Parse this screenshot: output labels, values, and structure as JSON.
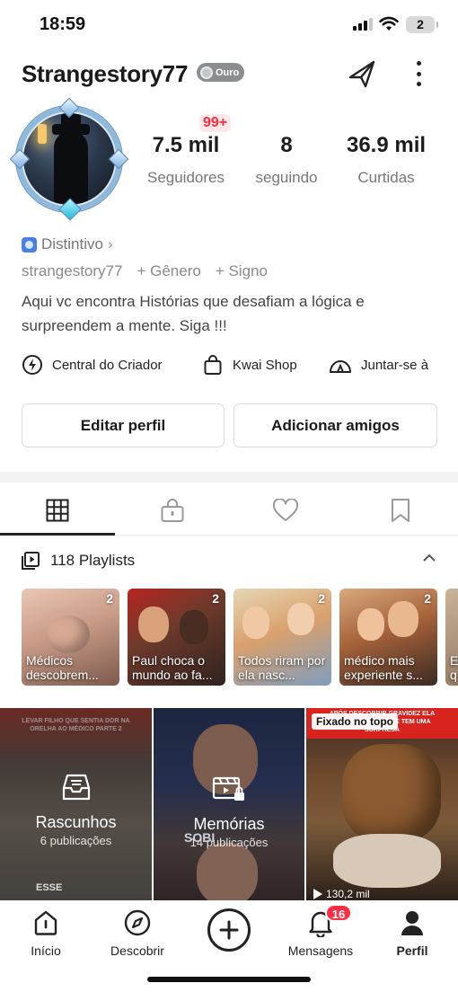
{
  "status": {
    "time": "18:59",
    "battery": "2"
  },
  "profile": {
    "username": "Strangestory77",
    "rank_badge": "Ouro",
    "notification_count": "99+",
    "stats": [
      {
        "value": "7.5 mil",
        "label": "Seguidores"
      },
      {
        "value": "8",
        "label": "seguindo"
      },
      {
        "value": "36.9 mil",
        "label": "Curtidas"
      }
    ],
    "badge_link": "Distintivo",
    "handle": "strangestory77",
    "gender_link": "+ Gênero",
    "sign_link": "+ Signo",
    "bio_line1": "Aqui vc encontra Histórias que desafiam a lógica e",
    "bio_line2": "surpreendem a mente. Siga !!!"
  },
  "shortcuts": [
    {
      "label": "Central do Criador",
      "icon": "lightning-icon"
    },
    {
      "label": "Kwai Shop",
      "icon": "shopping-bag-icon"
    },
    {
      "label": "Juntar-se à",
      "icon": "tent-icon"
    }
  ],
  "buttons": {
    "edit": "Editar perfil",
    "add_friends": "Adicionar amigos"
  },
  "tabs": [
    "grid-icon",
    "lock-icon",
    "heart-icon",
    "bookmark-icon"
  ],
  "playlists": {
    "header": "118 Playlists",
    "items": [
      {
        "count": "2",
        "title": "Médicos descobrem..."
      },
      {
        "count": "2",
        "title": "Paul choca o mundo ao fa..."
      },
      {
        "count": "2",
        "title": "Todos riram por ela nasc..."
      },
      {
        "count": "2",
        "title": "médico mais experiente s..."
      },
      {
        "count": "",
        "title": "E q"
      }
    ]
  },
  "grid": {
    "drafts": {
      "title": "Rascunhos",
      "sub": "6 publicações",
      "caption": "LEVAR FILHO QUE SENTIA DOR NA ORELHA AO MÉDICO PARTE 2",
      "bottom_text": "ESSE"
    },
    "memories": {
      "title": "Memórias",
      "sub": "14 publicações",
      "bottom_text": "SOBI"
    },
    "pinned": {
      "tag": "Fixado no topo",
      "caption": "APÓS DESCOBRIR GRAVIDEZ ELA INSTALA CÂMERAS E TEM UMA SURPRESA",
      "views": "130,2 mil"
    }
  },
  "nav": {
    "home": "Início",
    "discover": "Descobrir",
    "messages": "Mensagens",
    "messages_badge": "16",
    "profile": "Perfil"
  }
}
